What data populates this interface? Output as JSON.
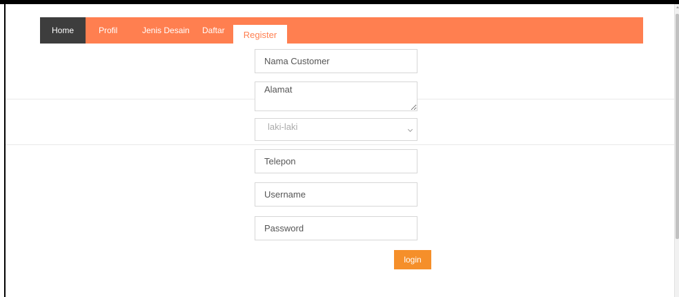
{
  "nav": {
    "items": [
      {
        "label": "Home"
      },
      {
        "label": "Profil"
      },
      {
        "label": "Jenis Desain"
      },
      {
        "label": "Daftar"
      }
    ],
    "active": "Home"
  },
  "register": {
    "tab_label": "Register",
    "fields": {
      "nama_placeholder": "Nama Customer",
      "alamat_placeholder": "Alamat",
      "gender_value": "laki-laki",
      "telepon_placeholder": "Telepon",
      "username_placeholder": "Username",
      "password_placeholder": "Password"
    },
    "submit_label": "login"
  },
  "colors": {
    "accent": "#ff7f50",
    "nav_active_bg": "#3d3d3d",
    "button": "#f58f2a"
  },
  "icons": {
    "select_arrow": "chevron-down-icon",
    "textarea_resize": "resize-handle-icon"
  }
}
